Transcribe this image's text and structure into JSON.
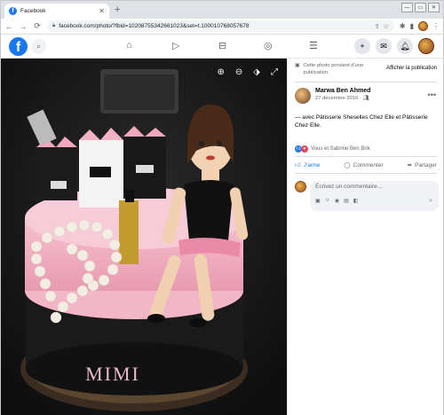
{
  "browser": {
    "tab_title": "Facebook",
    "url": "facebook.com/photo/?fbid=10208755342661023&set=t.100010768057678"
  },
  "notice": {
    "text": "Cette photo provient d'une publication.",
    "link": "Afficher la publication"
  },
  "post": {
    "author": "Marwa Ben Ahmed",
    "date": "27 décembre 2016 · ",
    "caption": "— avec Pâtisserie Sheselles Chez Elle et Pâtisserie Chez Elle.",
    "reactions_text": "Vous et Sabrine Ben Brik"
  },
  "actions": {
    "like": "J'aime",
    "comment": "Commenter",
    "share": "Partager"
  },
  "comment": {
    "placeholder": "Écrivez un commentaire…"
  },
  "photo": {
    "cake_text": "MIMI"
  },
  "colors": {
    "brand": "#1877f2",
    "love": "#f33e58"
  }
}
